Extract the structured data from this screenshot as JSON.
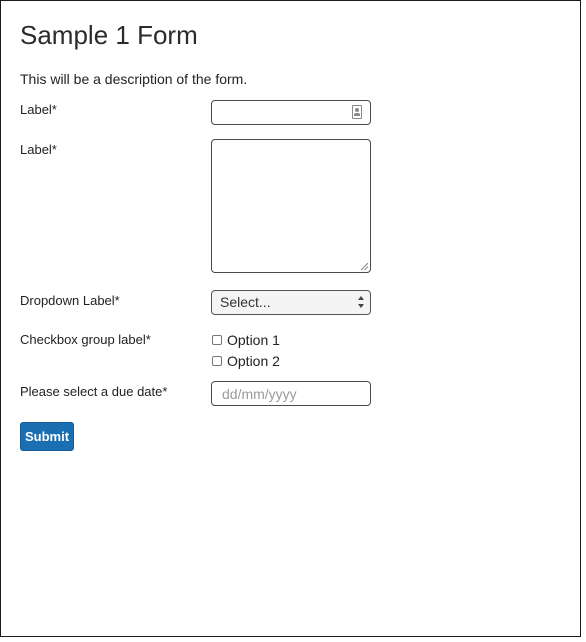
{
  "form": {
    "title": "Sample 1 Form",
    "description": "This will be a description of the form.",
    "fields": {
      "text_field": {
        "label": "Label*",
        "value": "",
        "icon": "contact-card-icon"
      },
      "textarea_field": {
        "label": "Label*",
        "value": ""
      },
      "dropdown": {
        "label": "Dropdown Label*",
        "selected": "Select..."
      },
      "checkbox_group": {
        "label": "Checkbox group label*",
        "options": [
          {
            "label": "Option 1",
            "checked": false
          },
          {
            "label": "Option 2",
            "checked": false
          }
        ]
      },
      "due_date": {
        "label": "Please select a due date*",
        "placeholder": "dd/mm/yyyy",
        "value": ""
      }
    },
    "submit_label": "Submit"
  },
  "colors": {
    "submit_background": "#1a6fb3",
    "input_border": "#4a4a4a",
    "text": "#222222",
    "placeholder": "#9a9a9a"
  }
}
